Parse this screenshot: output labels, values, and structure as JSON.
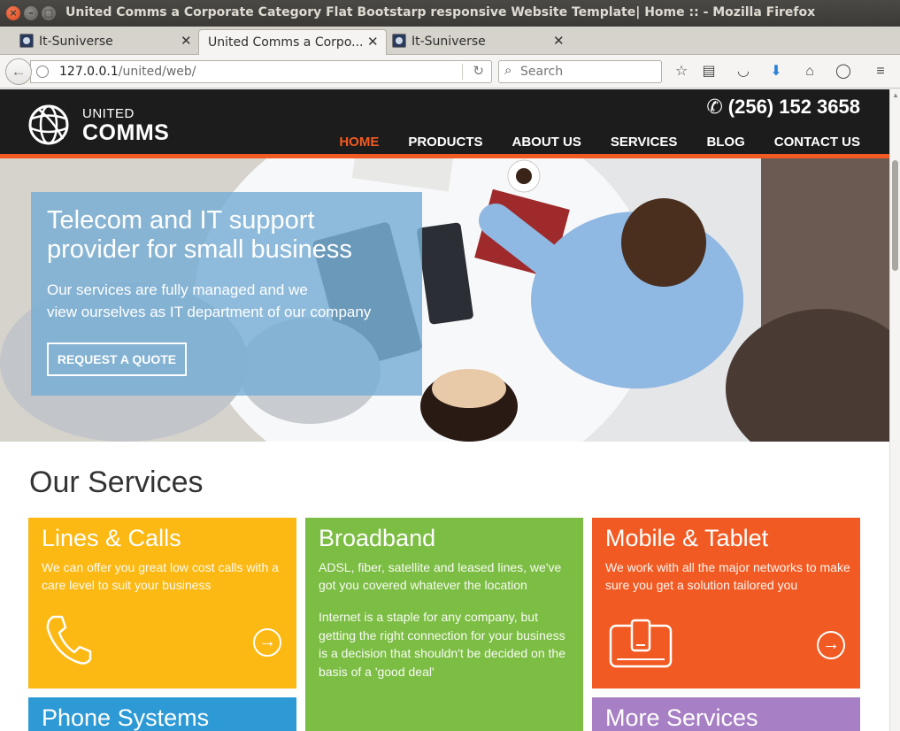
{
  "window": {
    "title": "United Comms a Corporate Category Flat Bootstarp responsive Website Template| Home :: - Mozilla Firefox"
  },
  "tabs": [
    {
      "label": "It-Suniverse"
    },
    {
      "label": "United Comms a Corpo..."
    },
    {
      "label": "It-Suniverse"
    }
  ],
  "address": {
    "host": "127.0.0.1",
    "path": "/united/web/"
  },
  "search": {
    "placeholder": "Search"
  },
  "site": {
    "logo_line1": "UNITED",
    "logo_line2": "COMMS",
    "phone": "(256) 152 3658",
    "menu": [
      "HOME",
      "PRODUCTS",
      "ABOUT US",
      "SERVICES",
      "BLOG",
      "CONTACT US"
    ],
    "active_menu": "HOME"
  },
  "hero": {
    "title": "Telecom and IT support provider for small business",
    "subtitle_line1": "Our services are fully managed and we",
    "subtitle_line2": "view ourselves as IT department of our company",
    "cta": "REQUEST A QUOTE"
  },
  "services": {
    "heading": "Our Services",
    "cards": [
      {
        "title": "Lines & Calls",
        "text": "We can offer you great low cost calls with a care level to suit your business",
        "color": "#fcb813",
        "icon": "phone-icon"
      },
      {
        "title": "Broadband",
        "text": "ADSL, fiber, satellite and leased lines, we've got you covered whatever the location",
        "text2": "Internet is a staple for any company, but getting the right connection for your business is a decision that shouldn't be decided on the basis of a 'good deal'",
        "color": "#7cbd43"
      },
      {
        "title": "Mobile & Tablet",
        "text": "We work with all the major networks to make sure you get a solution tailored you",
        "color": "#f15a22",
        "icon": "tablet-icon"
      },
      {
        "title": "Phone Systems",
        "color": "#2d9ad6"
      },
      {
        "title": "More Services",
        "color": "#a77fc4"
      }
    ]
  },
  "colors": {
    "accent": "#f15a22",
    "header_bg": "#1c1c1c"
  }
}
